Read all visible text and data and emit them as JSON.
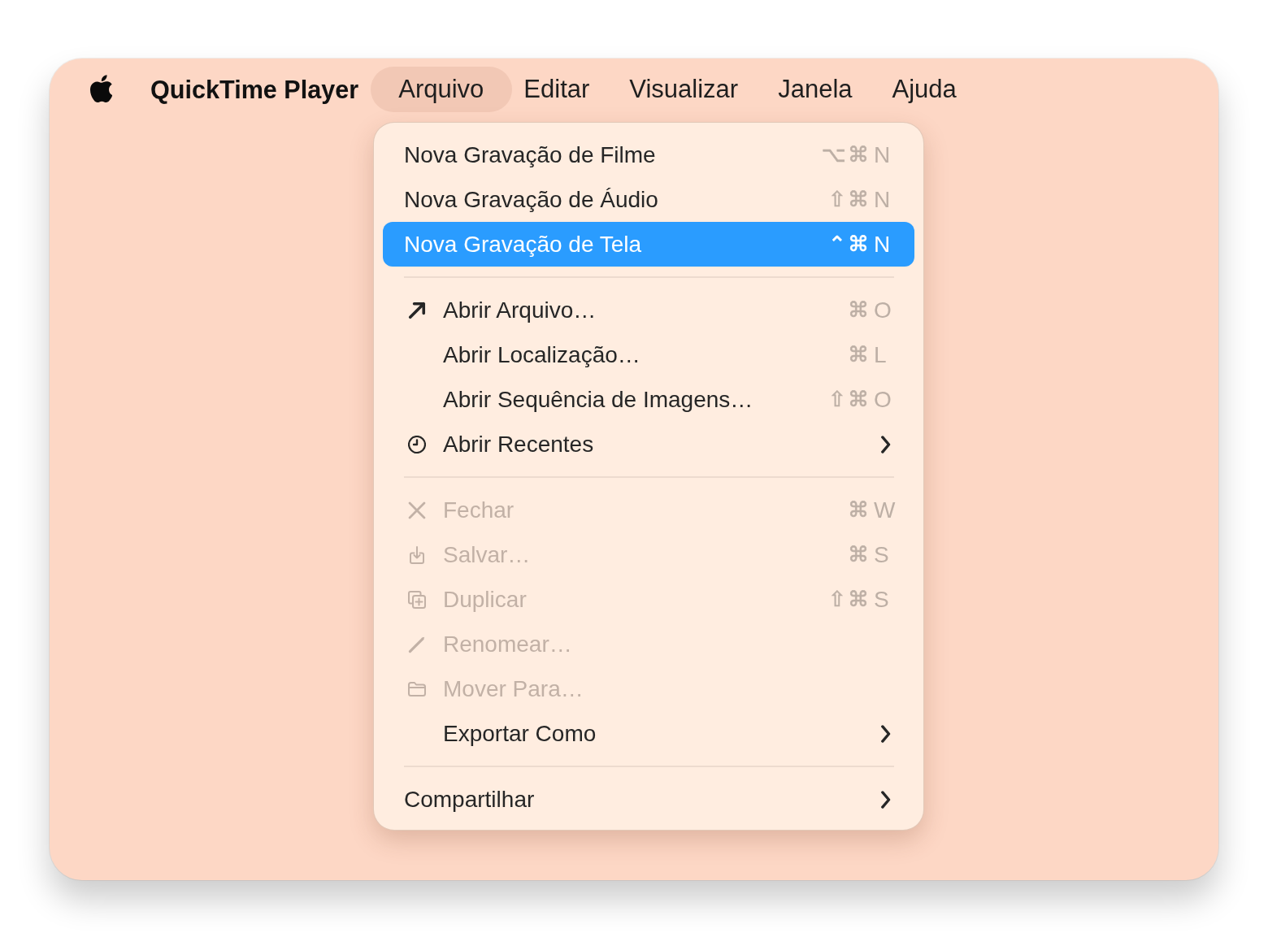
{
  "menu_bar": {
    "app_name": "QuickTime Player",
    "items": [
      {
        "label": "Arquivo",
        "selected": true
      },
      {
        "label": "Editar",
        "selected": false
      },
      {
        "label": "Visualizar",
        "selected": false
      },
      {
        "label": "Janela",
        "selected": false
      },
      {
        "label": "Ajuda",
        "selected": false
      }
    ]
  },
  "menu": {
    "sections": [
      {
        "items": [
          {
            "label": "Nova Gravação de Filme",
            "shortcut": {
              "modifiers": "⌥ ⌘",
              "key": "N"
            },
            "selected": false,
            "disabled": false,
            "submenu": false
          },
          {
            "label": "Nova Gravação de Áudio",
            "shortcut": {
              "modifiers": "⇧ ⌘",
              "key": "N"
            },
            "selected": false,
            "disabled": false,
            "submenu": false
          },
          {
            "label": "Nova Gravação de Tela",
            "shortcut": {
              "modifiers": "⌃ ⌘",
              "key": "N"
            },
            "selected": true,
            "disabled": false,
            "submenu": false
          }
        ]
      },
      {
        "items": [
          {
            "label": "Abrir Arquivo…",
            "shortcut": {
              "modifiers": "⌘",
              "key": "O"
            },
            "selected": false,
            "disabled": false,
            "submenu": false
          },
          {
            "label": "Abrir Localização…",
            "shortcut": {
              "modifiers": "⌘",
              "key": "L"
            },
            "selected": false,
            "disabled": false,
            "submenu": false
          },
          {
            "label": "Abrir Sequência de Imagens…",
            "shortcut": {
              "modifiers": "⇧ ⌘",
              "key": "O"
            },
            "selected": false,
            "disabled": false,
            "submenu": false
          },
          {
            "label": "Abrir Recentes",
            "selected": false,
            "disabled": false,
            "submenu": true
          }
        ]
      },
      {
        "items": [
          {
            "label": "Fechar",
            "shortcut": {
              "modifiers": "⌘",
              "key": "W"
            },
            "selected": false,
            "disabled": true,
            "submenu": false
          },
          {
            "label": "Salvar…",
            "shortcut": {
              "modifiers": "⌘",
              "key": "S"
            },
            "selected": false,
            "disabled": true,
            "submenu": false
          },
          {
            "label": "Duplicar",
            "shortcut": {
              "modifiers": "⇧ ⌘",
              "key": "S"
            },
            "selected": false,
            "disabled": true,
            "submenu": false
          },
          {
            "label": "Renomear…",
            "selected": false,
            "disabled": true,
            "submenu": false
          },
          {
            "label": "Mover Para…",
            "selected": false,
            "disabled": true,
            "submenu": false
          },
          {
            "label": "Exportar Como",
            "selected": false,
            "disabled": false,
            "submenu": true
          }
        ]
      },
      {
        "items": [
          {
            "label": "Compartilhar",
            "selected": false,
            "disabled": false,
            "submenu": true
          }
        ]
      }
    ]
  }
}
